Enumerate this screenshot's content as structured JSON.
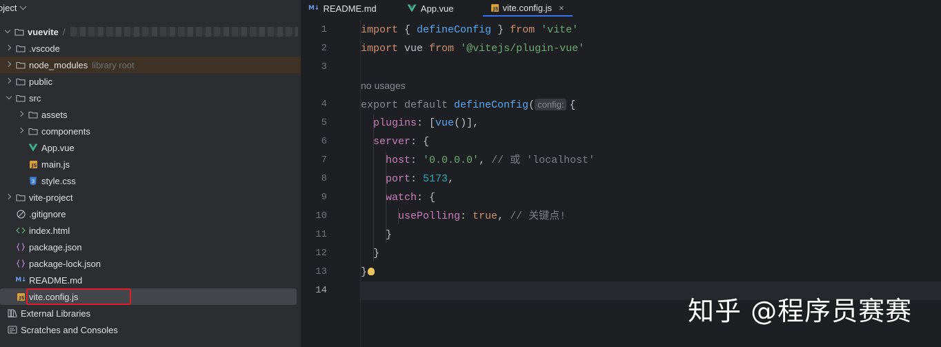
{
  "panel": {
    "title": "oject"
  },
  "tree": [
    {
      "label": "vuevite",
      "hint": "/",
      "icon": "folder-icon",
      "arrow": "down",
      "level": 0,
      "bold": true,
      "blur": true
    },
    {
      "label": ".vscode",
      "icon": "folder-icon",
      "arrow": "right",
      "level": 1
    },
    {
      "label": "node_modules",
      "hint": "library root",
      "icon": "folder-icon",
      "arrow": "right",
      "level": 1,
      "highlight": true
    },
    {
      "label": "public",
      "icon": "folder-icon",
      "arrow": "right",
      "level": 1
    },
    {
      "label": "src",
      "icon": "folder-icon",
      "arrow": "down",
      "level": 1
    },
    {
      "label": "assets",
      "icon": "folder-icon",
      "arrow": "right",
      "level": 2
    },
    {
      "label": "components",
      "icon": "folder-icon",
      "arrow": "right",
      "level": 2
    },
    {
      "label": "App.vue",
      "icon": "vue-icon",
      "level": 2
    },
    {
      "label": "main.js",
      "icon": "js-file-icon",
      "level": 2
    },
    {
      "label": "style.css",
      "icon": "css-file-icon",
      "level": 2
    },
    {
      "label": "vite-project",
      "icon": "folder-icon",
      "arrow": "right",
      "level": 1
    },
    {
      "label": ".gitignore",
      "icon": "gitignore-icon",
      "level": 1
    },
    {
      "label": "index.html",
      "icon": "html-file-icon",
      "level": 1
    },
    {
      "label": "package.json",
      "icon": "json-file-icon",
      "level": 1
    },
    {
      "label": "package-lock.json",
      "icon": "json-file-icon",
      "level": 1
    },
    {
      "label": "README.md",
      "icon": "markdown-file-icon",
      "level": 1
    },
    {
      "label": "vite.config.js",
      "icon": "js-file-icon",
      "level": 1,
      "selected": true
    },
    {
      "label": "External Libraries",
      "icon": "libraries-icon",
      "level": 0
    },
    {
      "label": "Scratches and Consoles",
      "icon": "scratches-icon",
      "level": 0
    }
  ],
  "tabs": [
    {
      "label": "README.md",
      "icon": "markdown-file-icon",
      "active": false
    },
    {
      "label": "App.vue",
      "icon": "vue-icon",
      "active": false
    },
    {
      "label": "vite.config.js",
      "icon": "js-file-icon",
      "active": true,
      "close": "×"
    }
  ],
  "editor": {
    "line_numbers": [
      "1",
      "2",
      "3",
      "4",
      "5",
      "6",
      "7",
      "8",
      "9",
      "10",
      "11",
      "12",
      "13",
      "14"
    ],
    "current_line": "14",
    "lines": [
      {
        "ln": "1",
        "tokens": [
          [
            "kw",
            "import"
          ],
          [
            "plain",
            " { "
          ],
          [
            "fn",
            "defineConfig"
          ],
          [
            "plain",
            " } "
          ],
          [
            "kw",
            "from"
          ],
          [
            "plain",
            " "
          ],
          [
            "str",
            "'vite'"
          ]
        ]
      },
      {
        "ln": "2",
        "tokens": [
          [
            "kw",
            "import"
          ],
          [
            "plain",
            " vue "
          ],
          [
            "kw",
            "from"
          ],
          [
            "plain",
            " "
          ],
          [
            "str",
            "'@vitejs/plugin-vue'"
          ]
        ]
      },
      {
        "ln": "3",
        "tokens": []
      },
      {
        "ln": "",
        "usage": "no usages"
      },
      {
        "ln": "4",
        "tokens": [
          [
            "faint",
            "export default "
          ],
          [
            "fn",
            "defineConfig"
          ],
          [
            "plain",
            "("
          ],
          [
            "inlay",
            "config:"
          ],
          [
            "plain",
            "{"
          ]
        ]
      },
      {
        "ln": "5",
        "tokens": [
          [
            "plain",
            "  "
          ],
          [
            "prop",
            "plugins"
          ],
          [
            "plain",
            ": ["
          ],
          [
            "fn",
            "vue"
          ],
          [
            "plain",
            "()],"
          ]
        ]
      },
      {
        "ln": "6",
        "tokens": [
          [
            "plain",
            "  "
          ],
          [
            "prop",
            "server"
          ],
          [
            "plain",
            ": {"
          ]
        ]
      },
      {
        "ln": "7",
        "tokens": [
          [
            "plain",
            "    "
          ],
          [
            "prop",
            "host"
          ],
          [
            "plain",
            ": "
          ],
          [
            "str",
            "'0.0.0.0'"
          ],
          [
            "plain",
            ", "
          ],
          [
            "cmt",
            "// 或 'localhost'"
          ]
        ]
      },
      {
        "ln": "8",
        "tokens": [
          [
            "plain",
            "    "
          ],
          [
            "prop",
            "port"
          ],
          [
            "plain",
            ": "
          ],
          [
            "num",
            "5173"
          ],
          [
            "plain",
            ","
          ]
        ]
      },
      {
        "ln": "9",
        "tokens": [
          [
            "plain",
            "    "
          ],
          [
            "prop",
            "watch"
          ],
          [
            "plain",
            ": {"
          ]
        ]
      },
      {
        "ln": "10",
        "tokens": [
          [
            "plain",
            "      "
          ],
          [
            "prop",
            "usePolling"
          ],
          [
            "plain",
            ": "
          ],
          [
            "kw",
            "true"
          ],
          [
            "plain",
            ", "
          ],
          [
            "cmt",
            "// 关键点!"
          ]
        ]
      },
      {
        "ln": "11",
        "tokens": [
          [
            "plain",
            "    }"
          ]
        ]
      },
      {
        "ln": "12",
        "tokens": [
          [
            "plain",
            "  }"
          ]
        ]
      },
      {
        "ln": "13",
        "tokens": [
          [
            "plain",
            "}"
          ]
        ],
        "bulb": true
      },
      {
        "ln": "14",
        "tokens": []
      }
    ]
  },
  "watermark": "知乎 @程序员赛赛",
  "colors": {
    "accent": "#3574f0",
    "selection_box": "#e11d2a",
    "folder": "#9da0a8"
  }
}
